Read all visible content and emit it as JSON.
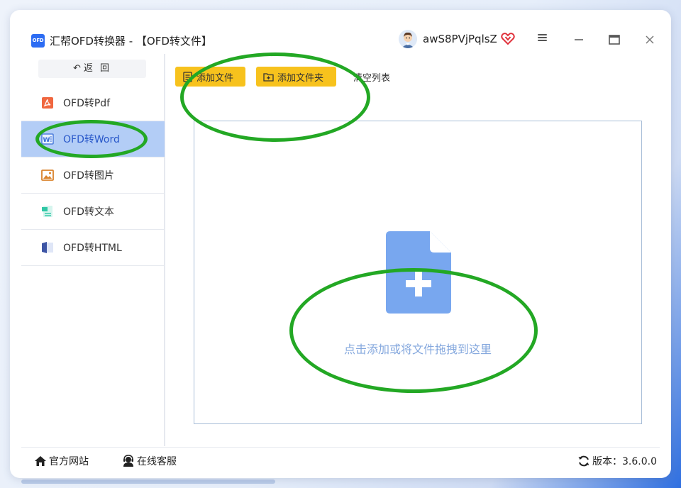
{
  "app": {
    "logo_text": "OFD",
    "title": "汇帮OFD转换器 - 【OFD转文件】",
    "username": "awS8PVjPqlsZ",
    "accent_color": "#2c6cf3"
  },
  "sidebar": {
    "back_label": "返 回",
    "items": [
      {
        "label": "OFD转Pdf",
        "icon": "pdf-icon"
      },
      {
        "label": "OFD转Word",
        "icon": "word-icon",
        "active": true
      },
      {
        "label": "OFD转图片",
        "icon": "image-icon"
      },
      {
        "label": "OFD转文本",
        "icon": "text-icon"
      },
      {
        "label": "OFD转HTML",
        "icon": "html-icon"
      }
    ],
    "active_color": "#b3cdf6"
  },
  "toolbar": {
    "add_file_label": "添加文件",
    "add_folder_label": "添加文件夹",
    "clear_label": "清空列表",
    "button_color": "#f7c21d"
  },
  "dropzone": {
    "hint": "点击添加或将文件拖拽到这里",
    "icon": "add-document-icon",
    "icon_color": "#78a7ef"
  },
  "footer": {
    "site_label": "官方网站",
    "support_label": "在线客服",
    "version_label": "版本：3.6.0.0"
  },
  "annotations": {
    "color": "#23a824"
  }
}
